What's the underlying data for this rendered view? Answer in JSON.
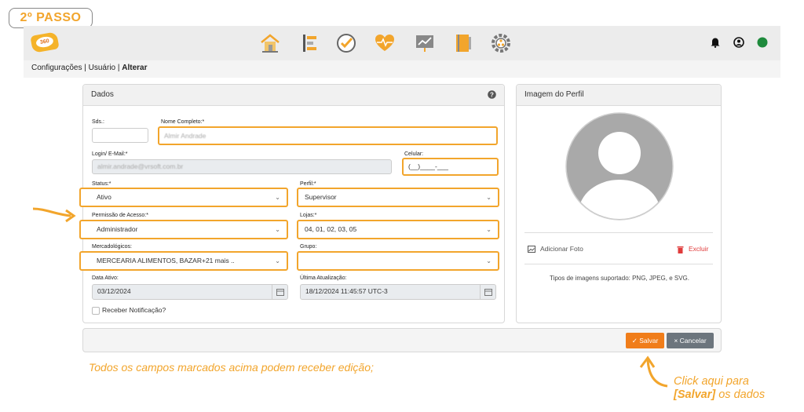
{
  "step_badge": "2º PASSO",
  "logo_text": "360",
  "nav_icons": [
    "home-icon",
    "list-icon",
    "check-circle-icon",
    "heartbeat-icon",
    "chart-board-icon",
    "notebook-icon",
    "gear-network-icon"
  ],
  "right_icons": [
    "bell-icon",
    "user-circle-icon",
    "status-dot-icon"
  ],
  "breadcrumb": {
    "p1": "Configurações",
    "sep": " | ",
    "p2": "Usuário",
    "p3": "Alterar"
  },
  "dados": {
    "title": "Dados",
    "sds": {
      "label": "Sds.:",
      "value": ""
    },
    "nome": {
      "label": "Nome Completo:*",
      "value": "Almir Andrade"
    },
    "login": {
      "label": "Login/ E-Mail:*",
      "value": "almir.andrade@vrsoft.com.br"
    },
    "celular": {
      "label": "Celular:",
      "value": "(__)____-___"
    },
    "status": {
      "label": "Status:*",
      "value": "Ativo"
    },
    "perfil": {
      "label": "Perfil:*",
      "value": "Supervisor"
    },
    "permissao": {
      "label": "Permissão de Acesso:*",
      "value": "Administrador"
    },
    "lojas": {
      "label": "Lojas:*",
      "value": "04, 01, 02, 03, 05"
    },
    "mercadologicos": {
      "label": "Mercadológicos:",
      "value": "MERCEARIA ALIMENTOS, BAZAR+21 mais .."
    },
    "grupo": {
      "label": "Grupo:",
      "value": ""
    },
    "data_ativo": {
      "label": "Data Ativo:",
      "value": "03/12/2024"
    },
    "ultima_atualizacao": {
      "label": "Última Atualização:",
      "value": "18/12/2024 11:45:57 UTC-3"
    },
    "receber_notificacao": {
      "label": "Receber Notificação?",
      "checked": false
    }
  },
  "perfil_panel": {
    "title": "Imagem do Perfil",
    "add_photo": "Adicionar Foto",
    "delete": "Excluir",
    "types": "Tipos de imagens suportado: PNG, JPEG, e SVG."
  },
  "actions": {
    "save": "Salvar",
    "cancel": "Cancelar"
  },
  "caption": "Todos os campos marcados acima podem receber edição;",
  "click_hint": {
    "line1": "Click aqui para",
    "save_word": "[Salvar]",
    "line2_rest": " os dados"
  },
  "colors": {
    "accent": "#f2a52c",
    "save_btn": "#f07d1a",
    "cancel_btn": "#6c757d",
    "delete": "#e03b3b",
    "status_dot": "#1e8a3c"
  }
}
